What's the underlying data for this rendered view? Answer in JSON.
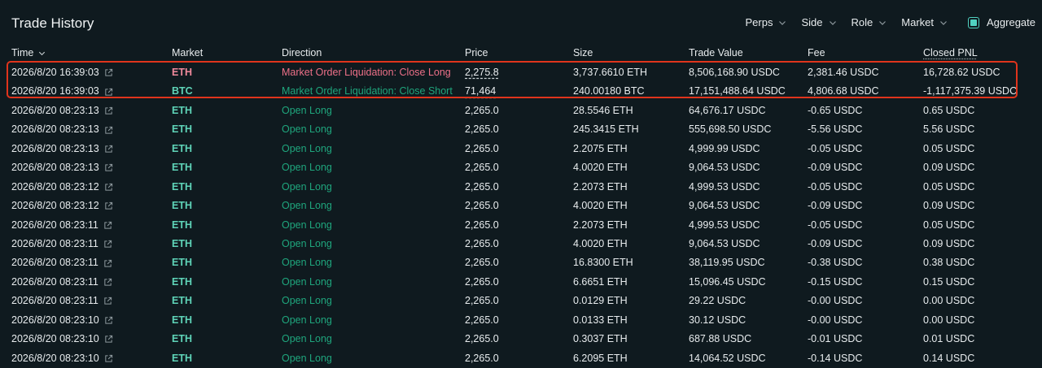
{
  "page": {
    "title": "Trade History"
  },
  "filters": {
    "items": [
      {
        "label": "Perps"
      },
      {
        "label": "Side"
      },
      {
        "label": "Role"
      },
      {
        "label": "Market"
      }
    ],
    "aggregate_label": "Aggregate",
    "aggregate_checked": true
  },
  "columns": {
    "time": "Time",
    "market": "Market",
    "direction": "Direction",
    "price": "Price",
    "size": "Size",
    "trade_value": "Trade Value",
    "fee": "Fee",
    "closed_pnl": "Closed PNL"
  },
  "colors": {
    "accent": "#50d2c1",
    "buy": "#1fa67d",
    "sell": "#ed7088",
    "highlight": "#e0341c",
    "background": "#0f1a1f"
  },
  "rows": [
    {
      "time": "2026/8/20 16:39:03",
      "market": "ETH",
      "side": "sell",
      "direction": "Market Order Liquidation: Close Long",
      "price": "2,275.8",
      "size": "3,737.6610 ETH",
      "trade_value": "8,506,168.90 USDC",
      "fee": "2,381.46 USDC",
      "closed_pnl": "16,728.62 USDC"
    },
    {
      "time": "2026/8/20 16:39:03",
      "market": "BTC",
      "side": "buy",
      "direction": "Market Order Liquidation: Close Short",
      "price": "71,464",
      "size": "240.00180 BTC",
      "trade_value": "17,151,488.64 USDC",
      "fee": "4,806.68 USDC",
      "closed_pnl": "-1,117,375.39 USDC"
    },
    {
      "time": "2026/8/20 08:23:13",
      "market": "ETH",
      "side": "buy",
      "direction": "Open Long",
      "price": "2,265.0",
      "size": "28.5546 ETH",
      "trade_value": "64,676.17 USDC",
      "fee": "-0.65 USDC",
      "closed_pnl": "0.65 USDC"
    },
    {
      "time": "2026/8/20 08:23:13",
      "market": "ETH",
      "side": "buy",
      "direction": "Open Long",
      "price": "2,265.0",
      "size": "245.3415 ETH",
      "trade_value": "555,698.50 USDC",
      "fee": "-5.56 USDC",
      "closed_pnl": "5.56 USDC"
    },
    {
      "time": "2026/8/20 08:23:13",
      "market": "ETH",
      "side": "buy",
      "direction": "Open Long",
      "price": "2,265.0",
      "size": "2.2075 ETH",
      "trade_value": "4,999.99 USDC",
      "fee": "-0.05 USDC",
      "closed_pnl": "0.05 USDC"
    },
    {
      "time": "2026/8/20 08:23:13",
      "market": "ETH",
      "side": "buy",
      "direction": "Open Long",
      "price": "2,265.0",
      "size": "4.0020 ETH",
      "trade_value": "9,064.53 USDC",
      "fee": "-0.09 USDC",
      "closed_pnl": "0.09 USDC"
    },
    {
      "time": "2026/8/20 08:23:12",
      "market": "ETH",
      "side": "buy",
      "direction": "Open Long",
      "price": "2,265.0",
      "size": "2.2073 ETH",
      "trade_value": "4,999.53 USDC",
      "fee": "-0.05 USDC",
      "closed_pnl": "0.05 USDC"
    },
    {
      "time": "2026/8/20 08:23:12",
      "market": "ETH",
      "side": "buy",
      "direction": "Open Long",
      "price": "2,265.0",
      "size": "4.0020 ETH",
      "trade_value": "9,064.53 USDC",
      "fee": "-0.09 USDC",
      "closed_pnl": "0.09 USDC"
    },
    {
      "time": "2026/8/20 08:23:11",
      "market": "ETH",
      "side": "buy",
      "direction": "Open Long",
      "price": "2,265.0",
      "size": "2.2073 ETH",
      "trade_value": "4,999.53 USDC",
      "fee": "-0.05 USDC",
      "closed_pnl": "0.05 USDC"
    },
    {
      "time": "2026/8/20 08:23:11",
      "market": "ETH",
      "side": "buy",
      "direction": "Open Long",
      "price": "2,265.0",
      "size": "4.0020 ETH",
      "trade_value": "9,064.53 USDC",
      "fee": "-0.09 USDC",
      "closed_pnl": "0.09 USDC"
    },
    {
      "time": "2026/8/20 08:23:11",
      "market": "ETH",
      "side": "buy",
      "direction": "Open Long",
      "price": "2,265.0",
      "size": "16.8300 ETH",
      "trade_value": "38,119.95 USDC",
      "fee": "-0.38 USDC",
      "closed_pnl": "0.38 USDC"
    },
    {
      "time": "2026/8/20 08:23:11",
      "market": "ETH",
      "side": "buy",
      "direction": "Open Long",
      "price": "2,265.0",
      "size": "6.6651 ETH",
      "trade_value": "15,096.45 USDC",
      "fee": "-0.15 USDC",
      "closed_pnl": "0.15 USDC"
    },
    {
      "time": "2026/8/20 08:23:11",
      "market": "ETH",
      "side": "buy",
      "direction": "Open Long",
      "price": "2,265.0",
      "size": "0.0129 ETH",
      "trade_value": "29.22 USDC",
      "fee": "-0.00 USDC",
      "closed_pnl": "0.00 USDC"
    },
    {
      "time": "2026/8/20 08:23:10",
      "market": "ETH",
      "side": "buy",
      "direction": "Open Long",
      "price": "2,265.0",
      "size": "0.0133 ETH",
      "trade_value": "30.12 USDC",
      "fee": "-0.00 USDC",
      "closed_pnl": "0.00 USDC"
    },
    {
      "time": "2026/8/20 08:23:10",
      "market": "ETH",
      "side": "buy",
      "direction": "Open Long",
      "price": "2,265.0",
      "size": "0.3037 ETH",
      "trade_value": "687.88 USDC",
      "fee": "-0.01 USDC",
      "closed_pnl": "0.01 USDC"
    },
    {
      "time": "2026/8/20 08:23:10",
      "market": "ETH",
      "side": "buy",
      "direction": "Open Long",
      "price": "2,265.0",
      "size": "6.2095 ETH",
      "trade_value": "14,064.52 USDC",
      "fee": "-0.14 USDC",
      "closed_pnl": "0.14 USDC"
    }
  ]
}
